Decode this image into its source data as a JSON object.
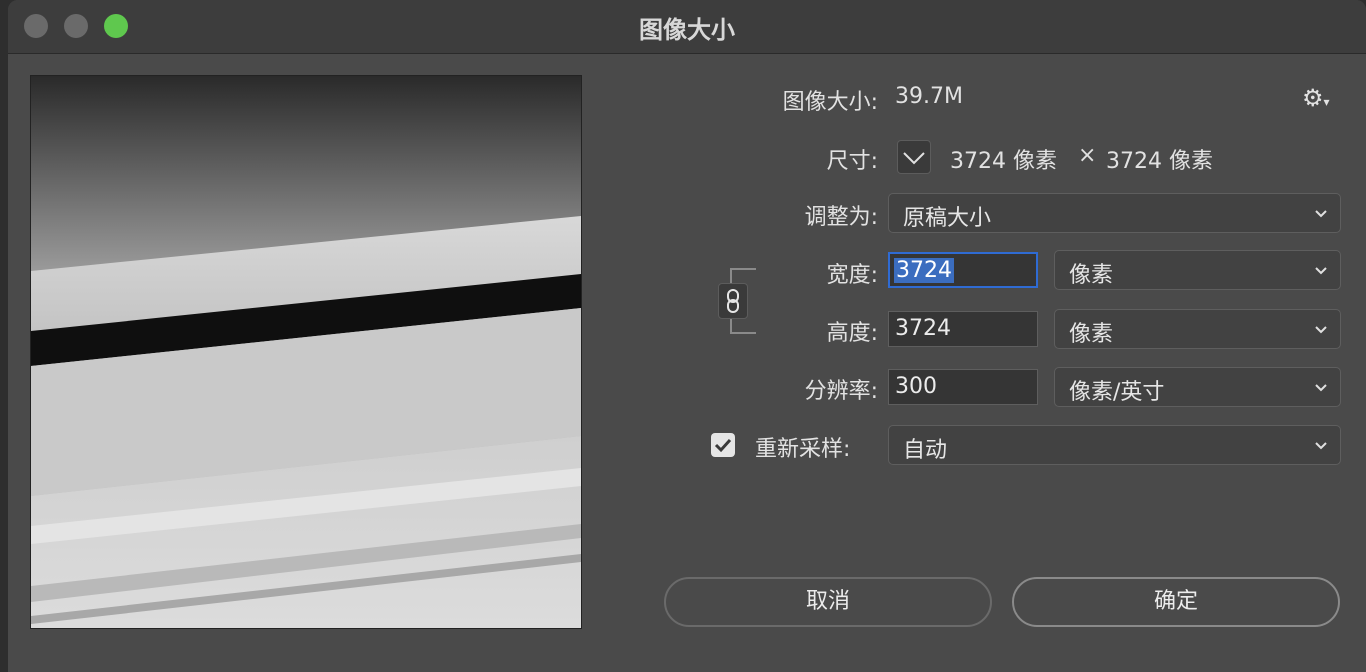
{
  "window": {
    "title": "图像大小"
  },
  "info": {
    "size_label": "图像大小:",
    "size_value": "39.7M",
    "dimensions_label": "尺寸:",
    "width_px": "3724 像素",
    "times": "×",
    "height_px": "3724 像素"
  },
  "fit_to": {
    "label": "调整为:",
    "value": "原稿大小"
  },
  "width": {
    "label": "宽度:",
    "value": "3724",
    "unit": "像素"
  },
  "height": {
    "label": "高度:",
    "value": "3724",
    "unit": "像素"
  },
  "resolution": {
    "label": "分辨率:",
    "value": "300",
    "unit": "像素/英寸"
  },
  "resample": {
    "label": "重新采样:",
    "value": "自动",
    "checked": true
  },
  "buttons": {
    "cancel": "取消",
    "ok": "确定"
  },
  "colors": {
    "maximize": "#5fc84e",
    "focus": "#2f6bd3"
  },
  "icons": [
    "gear-icon",
    "chevron-down-icon",
    "link-icon",
    "check-icon"
  ]
}
